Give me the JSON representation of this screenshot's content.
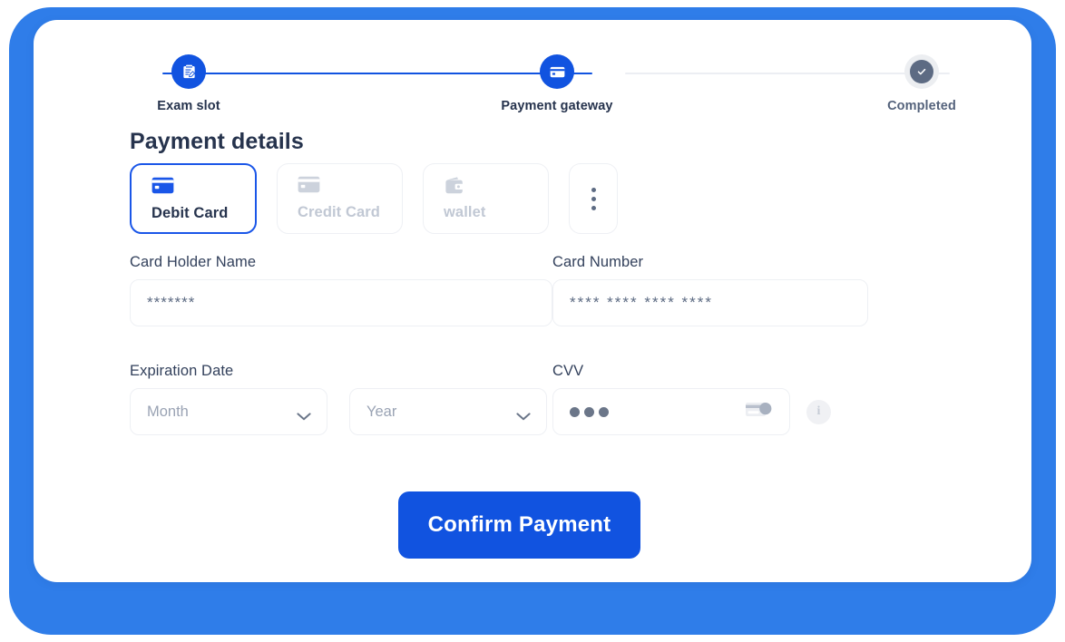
{
  "stepper": {
    "steps": [
      {
        "label": "Exam slot",
        "icon": "clipboard-edit-icon",
        "state": "active"
      },
      {
        "label": "Payment gateway",
        "icon": "credit-card-icon",
        "state": "active"
      },
      {
        "label": "Completed",
        "icon": "check-circle-icon",
        "state": "pending"
      }
    ],
    "colors": {
      "active": "#1153e0",
      "pending_ring": "#eceef1",
      "pending_fill": "#5d6b83",
      "track_done": "#1153e0",
      "track_todo": "#eceef3"
    }
  },
  "heading": {
    "title": "Payment details"
  },
  "methods": {
    "items": [
      {
        "label": "Debit Card",
        "icon": "credit-card-icon",
        "selected": true
      },
      {
        "label": "Credit Card",
        "icon": "credit-card-icon",
        "selected": false
      },
      {
        "label": "wallet",
        "icon": "wallet-icon",
        "selected": false
      }
    ],
    "more_label": "More payment methods",
    "more_icon": "kebab-menu-icon"
  },
  "form": {
    "card_holder": {
      "label": "Card Holder Name",
      "value": "*******",
      "placeholder": "Card Holder Name"
    },
    "card_number": {
      "label": "Card Number",
      "value": "**** **** **** ****",
      "placeholder": "**** **** **** ****"
    },
    "expiration": {
      "label": "Expiration Date",
      "month": {
        "value": "Month",
        "placeholder": "Month",
        "icon": "chevron-down-icon"
      },
      "year": {
        "value": "Year",
        "placeholder": "Year",
        "icon": "chevron-down-icon"
      }
    },
    "cvv": {
      "label": "CVV",
      "value": "•••",
      "placeholder": "CVV",
      "icon": "card-back-cvv-icon",
      "info_icon": "info-icon",
      "info_glyph": "i"
    }
  },
  "actions": {
    "confirm_label": "Confirm Payment",
    "confirm_color": "#1153e0"
  },
  "theme": {
    "accent": "#1153e0",
    "text_dark": "#26334d",
    "text_muted": "#9aa3b4",
    "text_disabled": "#c1c8d4",
    "border": "#eef0f4",
    "card_bg": "#ffffff",
    "frame_blue": "#2f7de9"
  }
}
